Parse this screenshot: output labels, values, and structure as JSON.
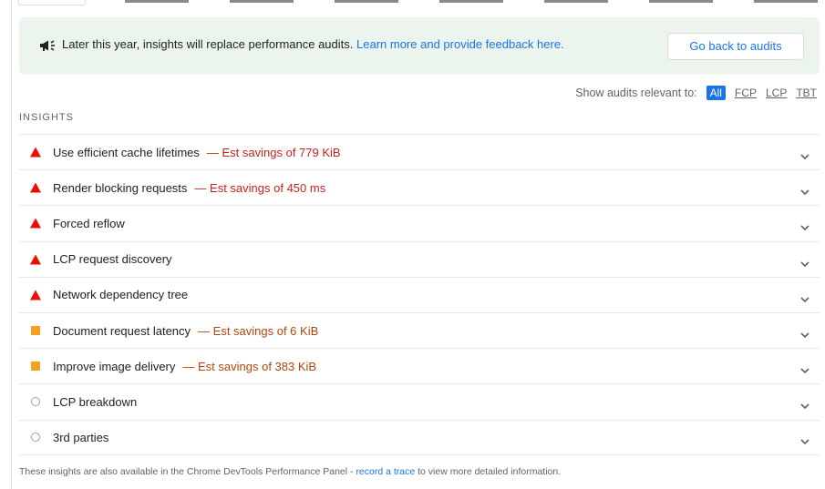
{
  "banner": {
    "text": "Later this year, insights will replace performance audits.",
    "link": "Learn more and provide feedback here.",
    "button": "Go back to audits",
    "icon": "megaphone-icon"
  },
  "filter": {
    "label": "Show audits relevant to:",
    "options": [
      "All",
      "FCP",
      "LCP",
      "TBT"
    ],
    "selected": "All"
  },
  "section": {
    "title": "INSIGHTS"
  },
  "insights": [
    {
      "title": "Use efficient cache lifetimes",
      "savings": "— Est savings of 779 KiB",
      "status": "fail"
    },
    {
      "title": "Render blocking requests",
      "savings": "— Est savings of 450 ms",
      "status": "fail"
    },
    {
      "title": "Forced reflow",
      "savings": "",
      "status": "fail"
    },
    {
      "title": "LCP request discovery",
      "savings": "",
      "status": "fail"
    },
    {
      "title": "Network dependency tree",
      "savings": "",
      "status": "fail"
    },
    {
      "title": "Document request latency",
      "savings": "— Est savings of 6 KiB",
      "status": "average"
    },
    {
      "title": "Improve image delivery",
      "savings": "— Est savings of 383 KiB",
      "status": "average"
    },
    {
      "title": "LCP breakdown",
      "savings": "",
      "status": "info"
    },
    {
      "title": "3rd parties",
      "savings": "",
      "status": "info"
    }
  ],
  "footer": {
    "before": "These insights are also available in the Chrome DevTools Performance Panel - ",
    "link": "record a trace",
    "after": " to view more detailed information."
  },
  "colors": {
    "fail": "#eb0f00",
    "average": "#f4a021",
    "info": "#9aa0a6",
    "link": "#1a73e8",
    "banner_bg": "#ebf5ee"
  }
}
